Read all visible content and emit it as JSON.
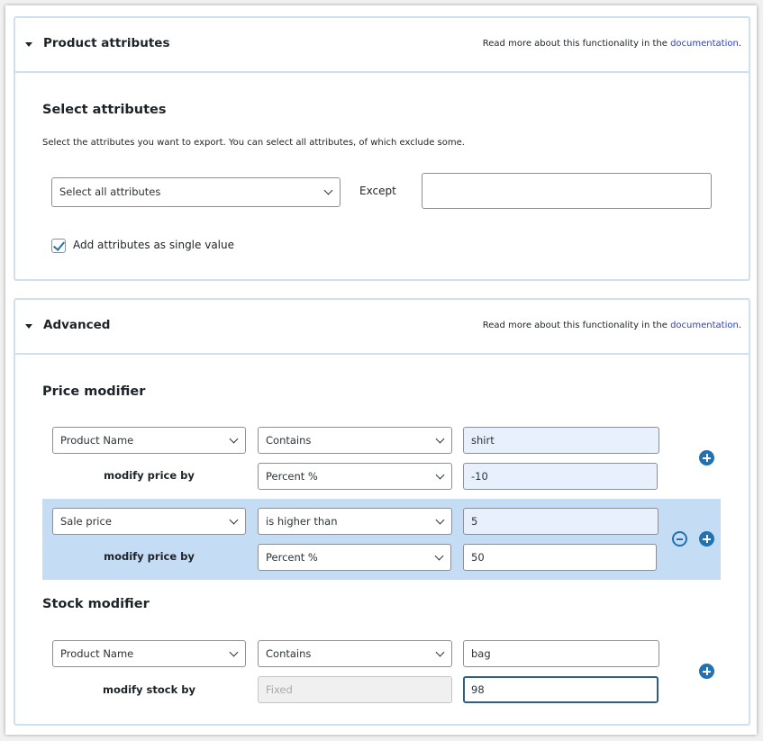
{
  "product_attributes": {
    "title": "Product attributes",
    "readmore_prefix": "Read more about this functionality in the ",
    "readmore_link": "documentation",
    "readmore_suffix": ".",
    "section_title": "Select attributes",
    "description": "Select the attributes you want to export. You can select all attributes, of which exclude some.",
    "select_value": "Select all attributes",
    "except_label": "Except",
    "except_value": "",
    "checkbox_label": "Add attributes as single value",
    "checkbox_checked": true
  },
  "advanced": {
    "title": "Advanced",
    "readmore_prefix": "Read more about this functionality in the ",
    "readmore_link": "documentation",
    "readmore_suffix": ".",
    "price_modifier": {
      "title": "Price modifier",
      "rows": [
        {
          "field": "Product Name",
          "condition": "Contains",
          "value": "shirt",
          "modify_label": "modify price by",
          "modify_type": "Percent %",
          "modify_value": "-10"
        },
        {
          "field": "Sale price",
          "condition": "is higher than",
          "value": "5",
          "modify_label": "modify price by",
          "modify_type": "Percent %",
          "modify_value": "50"
        }
      ]
    },
    "stock_modifier": {
      "title": "Stock modifier",
      "rows": [
        {
          "field": "Product Name",
          "condition": "Contains",
          "value": "bag",
          "modify_label": "modify stock by",
          "modify_type": "Fixed",
          "modify_value": "98"
        }
      ]
    }
  },
  "icons": {
    "caret": "caret-down-icon",
    "chevron": "chevron-down-icon",
    "add": "plus-circle-icon",
    "remove": "minus-circle-icon"
  },
  "colors": {
    "accent": "#2271b1",
    "highlight_row": "#c5dcf5",
    "autofill_input": "#e8f0fe",
    "panel_border": "#cfe0f0"
  }
}
